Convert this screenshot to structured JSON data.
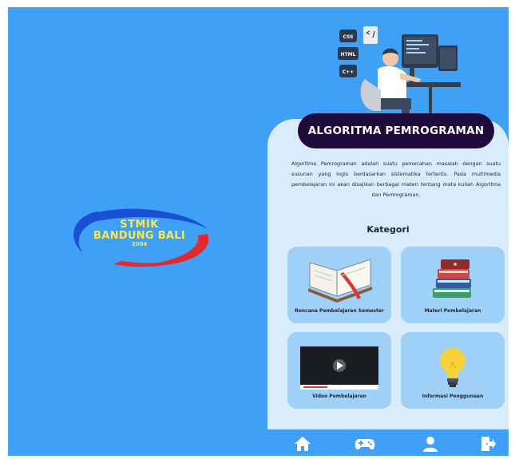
{
  "splash": {
    "logo_line1": "STMIK",
    "logo_line2": "BANDUNG BALI",
    "logo_year": "2004",
    "background_color": "#3fa0f5"
  },
  "app": {
    "title": "ALGORITMA PEMROGRAMAN",
    "hero_badges": [
      "CSS",
      "HTML",
      "C++"
    ],
    "description": "Algoritma Pemrograman adalah suatu pemecahan masalah dengan suatu susunan yang logis berdasarkan sistematika tertentu. Pada multimedia pembelajaran ini akan disajikan berbagai materi tentang mata kuliah Algoritma dan Pemrograman.",
    "section_title": "Kategori",
    "categories": [
      {
        "label": "Rencana Pembelajaran Semester",
        "icon": "open-book-icon"
      },
      {
        "label": "Materi Pembelajaran",
        "icon": "book-stack-icon"
      },
      {
        "label": "Video Pembelajaran",
        "icon": "video-player-icon"
      },
      {
        "label": "Informasi Penggunaan",
        "icon": "light-bulb-icon"
      }
    ],
    "nav": [
      {
        "icon": "home-icon"
      },
      {
        "icon": "gamepad-icon"
      },
      {
        "icon": "user-icon"
      },
      {
        "icon": "logout-icon"
      }
    ],
    "colors": {
      "primary": "#3fa0f5",
      "panel": "#d9ecfb",
      "card": "#9fd0f7",
      "title_pill": "#1f0c3c"
    }
  }
}
